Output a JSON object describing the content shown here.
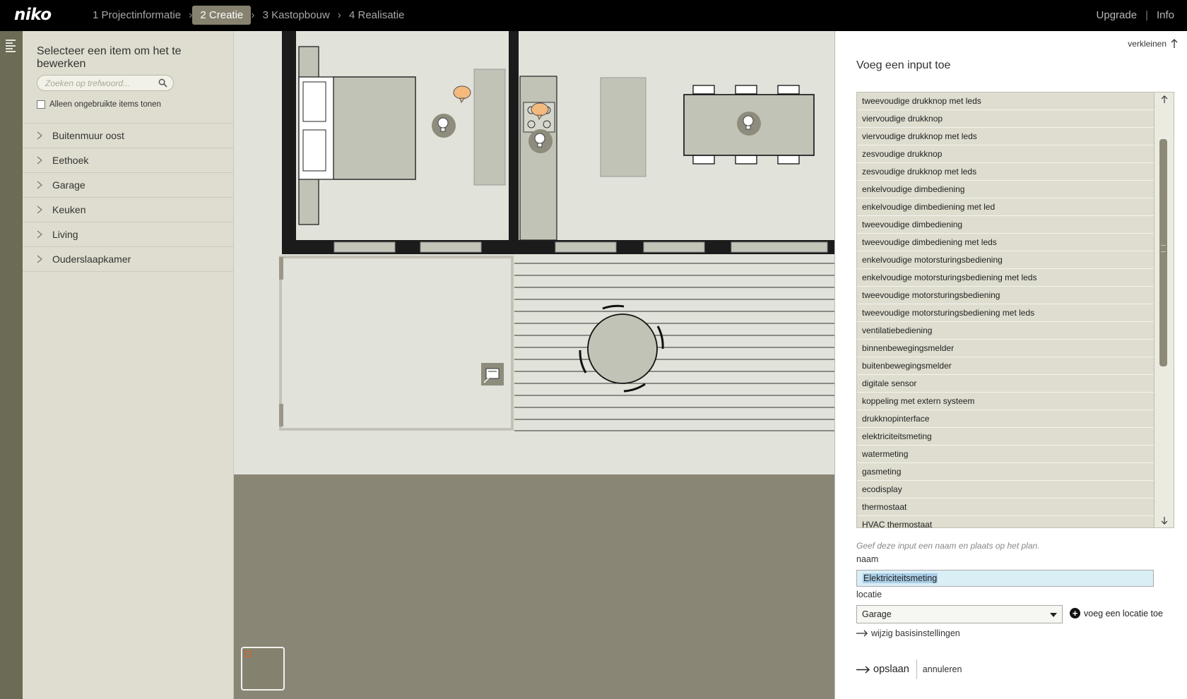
{
  "header": {
    "logo": "niko",
    "steps": [
      {
        "label": "1 Projectinformatie",
        "active": false
      },
      {
        "label": "2 Creatie",
        "active": true
      },
      {
        "label": "3 Kastopbouw",
        "active": false
      },
      {
        "label": "4 Realisatie",
        "active": false
      }
    ],
    "upgrade": "Upgrade",
    "separator": "|",
    "info": "Info"
  },
  "sidebar": {
    "title": "Selecteer een item om het te bewerken",
    "search_placeholder": "Zoeken op trefwoord...",
    "only_unused_label": "Alleen ongebruikte items tonen",
    "items": [
      {
        "label": "Buitenmuur oost"
      },
      {
        "label": "Eethoek"
      },
      {
        "label": "Garage"
      },
      {
        "label": "Keuken"
      },
      {
        "label": "Living"
      },
      {
        "label": "Ouderslaapkamer"
      }
    ]
  },
  "panel": {
    "collapse_label": "verkleinen",
    "title": "Voeg een input toe",
    "input_types": [
      "tweevoudige drukknop met leds",
      "viervoudige drukknop",
      "viervoudige drukknop met leds",
      "zesvoudige drukknop",
      "zesvoudige drukknop met leds",
      "enkelvoudige dimbediening",
      "enkelvoudige dimbediening met led",
      "tweevoudige dimbediening",
      "tweevoudige dimbediening met leds",
      "enkelvoudige motorsturingsbediening",
      "enkelvoudige motorsturingsbediening met leds",
      "tweevoudige motorsturingsbediening",
      "tweevoudige motorsturingsbediening met leds",
      "ventilatiebediening",
      "binnenbewegingsmelder",
      "buitenbewegingsmelder",
      "digitale sensor",
      "koppeling met extern systeem",
      "drukknopinterface",
      "elektriciteitsmeting",
      "watermeting",
      "gasmeting",
      "ecodisplay",
      "thermostaat",
      "HVAC thermostaat"
    ],
    "hint": "Geef deze input een naam en plaats op het plan.",
    "name_label": "naam",
    "name_value": "Elektriciteitsmeting",
    "location_label": "locatie",
    "location_value": "Garage",
    "add_location": "voeg een locatie toe",
    "change_settings": "wijzig basisinstellingen",
    "save": "opslaan",
    "cancel": "annuleren"
  },
  "colors": {
    "topbar": "#000000",
    "active_step": "#86826f",
    "sidebar": "#deddcf",
    "canvas_floor": "#e1e2da",
    "canvas_background": "#8a8676",
    "furniture": "#c2c3b7",
    "wall": "#1a1a1a",
    "selection": "#a9cde6"
  }
}
